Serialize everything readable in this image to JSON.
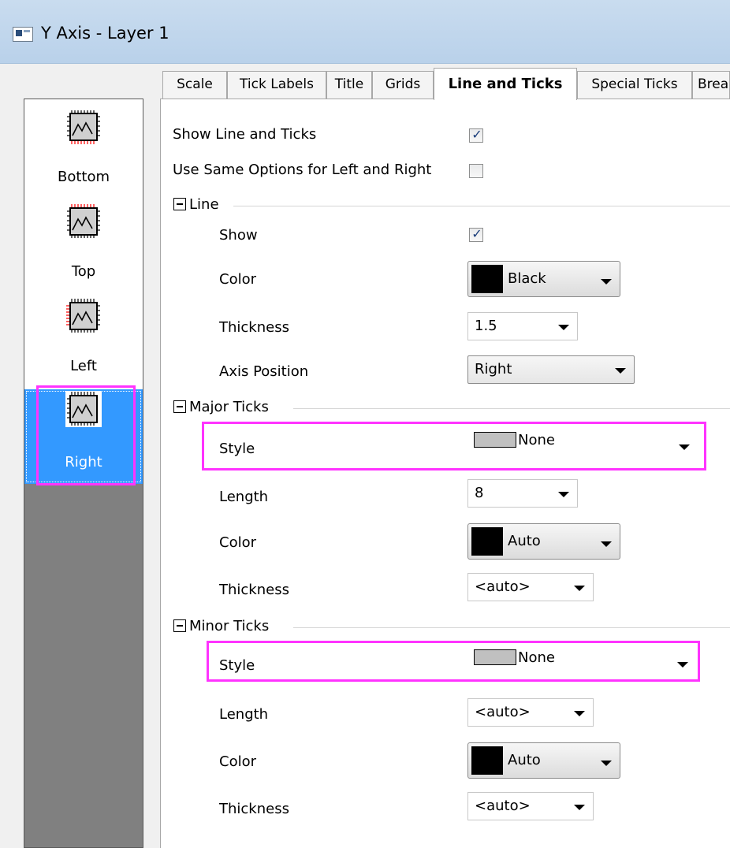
{
  "window": {
    "title": "Y Axis - Layer 1"
  },
  "axis_list": [
    {
      "label": "Bottom",
      "selected": false
    },
    {
      "label": "Top",
      "selected": false
    },
    {
      "label": "Left",
      "selected": false
    },
    {
      "label": "Right",
      "selected": true
    }
  ],
  "tabs": [
    {
      "label": "Scale"
    },
    {
      "label": "Tick Labels"
    },
    {
      "label": "Title"
    },
    {
      "label": "Grids"
    },
    {
      "label": "Line and Ticks",
      "active": true
    },
    {
      "label": "Special Ticks"
    },
    {
      "label": "Brea"
    }
  ],
  "options": {
    "show_line_ticks": {
      "label": "Show Line and Ticks",
      "checked": true
    },
    "same_left_right": {
      "label": "Use Same Options for Left and Right",
      "checked": false
    }
  },
  "line": {
    "header": "Line",
    "show": {
      "label": "Show",
      "checked": true
    },
    "color": {
      "label": "Color",
      "value": "Black",
      "swatch": "#000000"
    },
    "thickness": {
      "label": "Thickness",
      "value": "1.5"
    },
    "axis_position": {
      "label": "Axis Position",
      "value": "Right"
    }
  },
  "major_ticks": {
    "header": "Major Ticks",
    "style": {
      "label": "Style",
      "value": "None"
    },
    "length": {
      "label": "Length",
      "value": "8"
    },
    "color": {
      "label": "Color",
      "value": "Auto",
      "swatch": "#000000"
    },
    "thickness": {
      "label": "Thickness",
      "value": "<auto>"
    }
  },
  "minor_ticks": {
    "header": "Minor Ticks",
    "style": {
      "label": "Style",
      "value": "None"
    },
    "length": {
      "label": "Length",
      "value": "<auto>"
    },
    "color": {
      "label": "Color",
      "value": "Auto",
      "swatch": "#000000"
    },
    "thickness": {
      "label": "Thickness",
      "value": "<auto>"
    }
  },
  "colors": {
    "highlight": "#ff33ff",
    "selection": "#3399ff",
    "check": "#1a3d7a"
  }
}
